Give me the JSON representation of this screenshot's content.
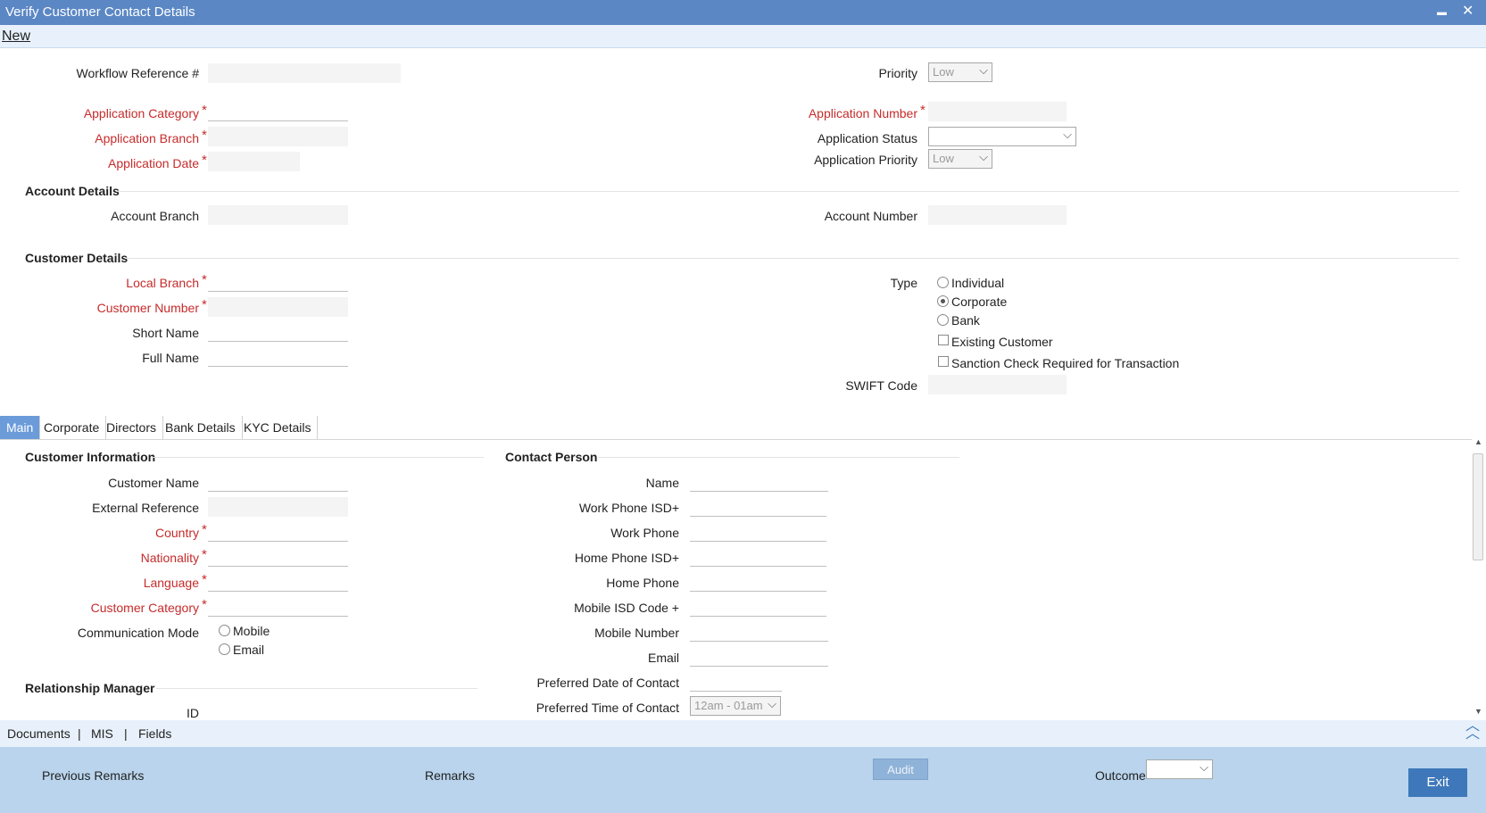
{
  "window": {
    "title": "Verify Customer Contact Details",
    "minimize_glyph": "▬",
    "close_glyph": "✕"
  },
  "menu": {
    "new_label": "New"
  },
  "header": {
    "workflow_ref_label": "Workflow Reference #",
    "priority_label": "Priority",
    "priority_value": "Low",
    "app_category_label": "Application Category",
    "app_number_label": "Application Number",
    "app_branch_label": "Application Branch",
    "app_status_label": "Application Status",
    "app_date_label": "Application Date",
    "app_priority_label": "Application Priority",
    "app_priority_value": "Low"
  },
  "account_details": {
    "title": "Account Details",
    "branch_label": "Account Branch",
    "number_label": "Account Number"
  },
  "customer_details": {
    "title": "Customer Details",
    "local_branch_label": "Local Branch",
    "customer_number_label": "Customer Number",
    "short_name_label": "Short Name",
    "full_name_label": "Full Name",
    "type_label": "Type",
    "type_options": [
      "Individual",
      "Corporate",
      "Bank"
    ],
    "existing_customer_label": "Existing Customer",
    "sanction_check_label": "Sanction Check Required for Transaction",
    "swift_label": "SWIFT Code"
  },
  "tabs": [
    "Main",
    "Corporate",
    "Directors",
    "Bank Details",
    "KYC Details"
  ],
  "customer_information": {
    "title": "Customer Information",
    "customer_name_label": "Customer Name",
    "external_ref_label": "External Reference",
    "country_label": "Country",
    "nationality_label": "Nationality",
    "language_label": "Language",
    "category_label": "Customer Category",
    "comm_mode_label": "Communication Mode",
    "comm_options": [
      "Mobile",
      "Email"
    ]
  },
  "relationship_manager": {
    "title": "Relationship Manager",
    "id_label": "ID"
  },
  "contact_person": {
    "title": "Contact Person",
    "name_label": "Name",
    "work_isd_label": "Work Phone ISD+",
    "work_phone_label": "Work Phone",
    "home_isd_label": "Home Phone ISD+",
    "home_phone_label": "Home Phone",
    "mobile_isd_label": "Mobile ISD Code +",
    "mobile_number_label": "Mobile Number",
    "email_label": "Email",
    "pref_date_label": "Preferred Date of Contact",
    "pref_time_label": "Preferred Time of Contact",
    "pref_time_value": "12am - 01am"
  },
  "links": {
    "documents": "Documents",
    "mis": "MIS",
    "fields": "Fields",
    "separator": "|"
  },
  "footer": {
    "previous_remarks_label": "Previous Remarks",
    "remarks_label": "Remarks",
    "audit_label": "Audit",
    "outcome_label": "Outcome",
    "exit_label": "Exit"
  },
  "required_mark": "*",
  "icons": {
    "dropdown": "chevron-down-icon",
    "scroll_top": "double-chevron-up-icon"
  },
  "colors": {
    "titlebar": "#5b87c4",
    "required": "#c62b2b",
    "footer": "#b9d4ec",
    "tab_active": "#6b9bd9",
    "exit_button": "#3f78ba"
  }
}
